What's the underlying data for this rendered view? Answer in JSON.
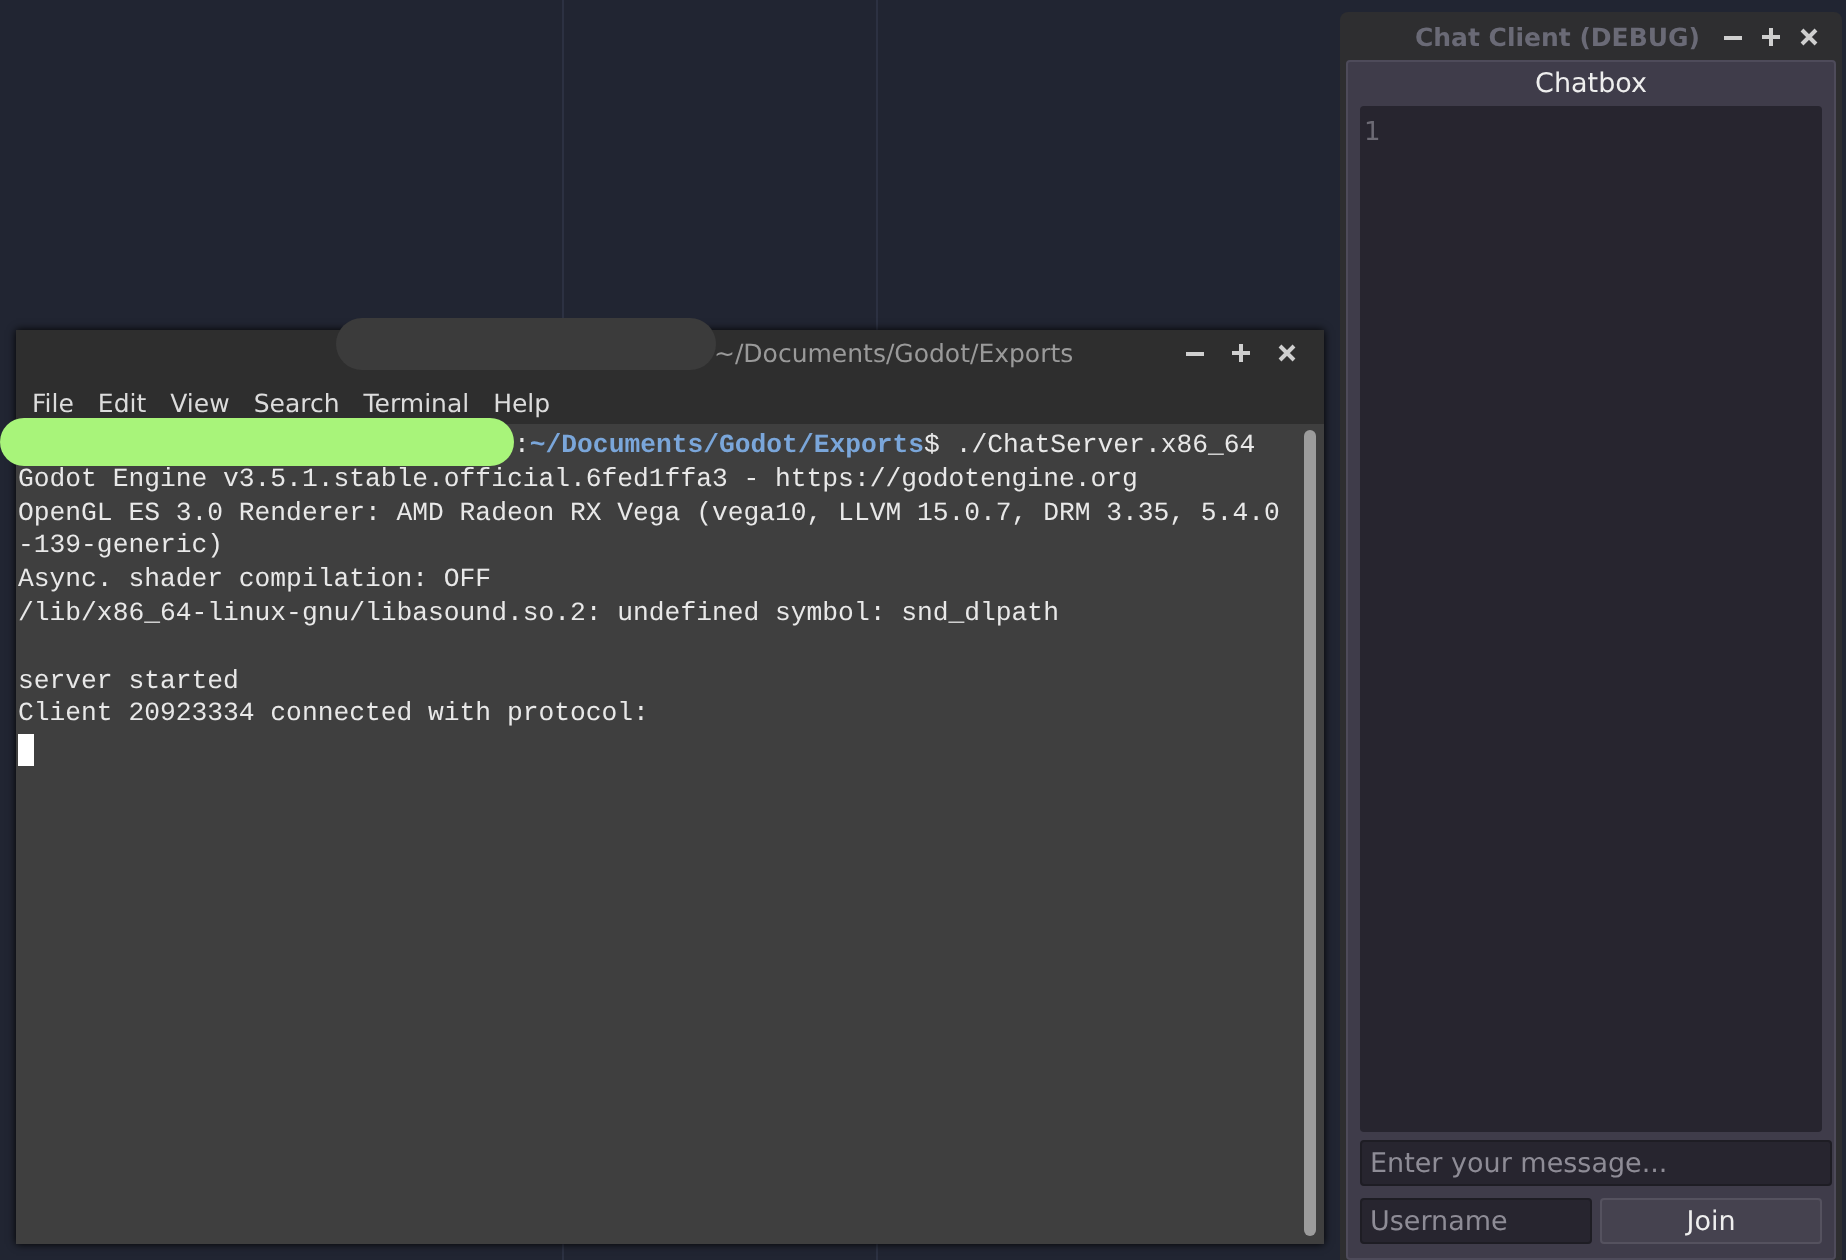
{
  "terminal": {
    "title": "~/Documents/Godot/Exports",
    "title_redacted": true,
    "menu": [
      "File",
      "Edit",
      "View",
      "Search",
      "Terminal",
      "Help"
    ],
    "lines": [
      {
        "kind": "prompt",
        "redacted": true,
        "segments": [
          {
            "kind": "plain",
            "text": ":"
          },
          {
            "kind": "path",
            "text": "~/Documents/Godot/Exports"
          },
          {
            "kind": "plain",
            "text": "$ ./ChatServer.x86_64"
          }
        ]
      },
      {
        "kind": "output",
        "text": "Godot Engine v3.5.1.stable.official.6fed1ffa3 - https://godotengine.org"
      },
      {
        "kind": "output",
        "text": "OpenGL ES 3.0 Renderer: AMD Radeon RX Vega (vega10, LLVM 15.0.7, DRM 3.35, 5.4.0"
      },
      {
        "kind": "output",
        "text": "-139-generic)"
      },
      {
        "kind": "output",
        "text": "Async. shader compilation: OFF"
      },
      {
        "kind": "output",
        "text": "/lib/x86_64-linux-gnu/libasound.so.2: undefined symbol: snd_dlpath"
      },
      {
        "kind": "blank"
      },
      {
        "kind": "output",
        "text": "server started"
      },
      {
        "kind": "output",
        "text": "Client 20923334 connected with protocol:"
      },
      {
        "kind": "cursor"
      }
    ]
  },
  "chat_client": {
    "title": "Chat Client (DEBUG)",
    "heading": "Chatbox",
    "line_number": "1",
    "message": {
      "placeholder": "Enter your message..."
    },
    "username": {
      "placeholder": "Username"
    },
    "join_button": "Join"
  }
}
